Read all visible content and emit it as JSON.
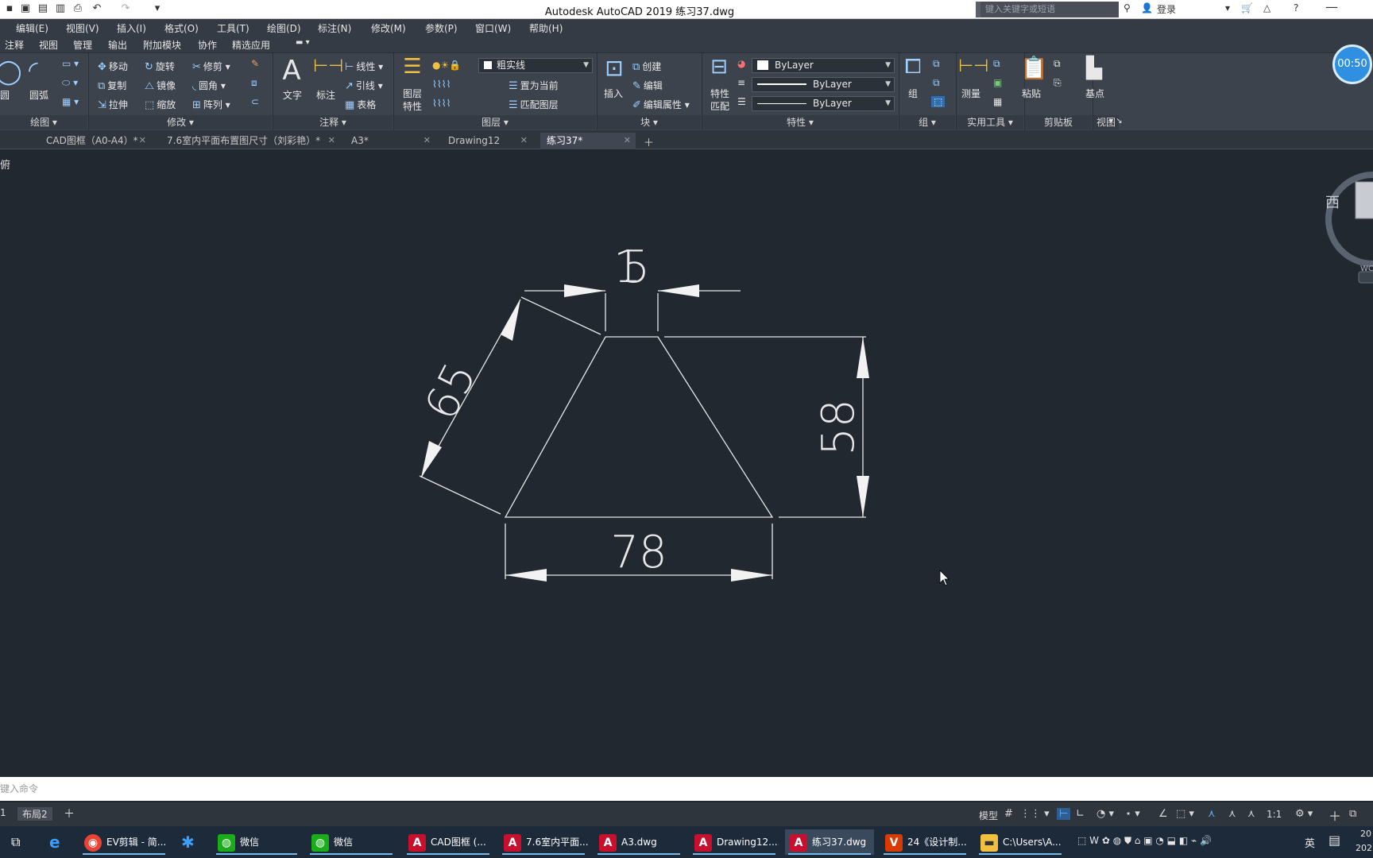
{
  "titlebar": {
    "title": "Autodesk AutoCAD 2019    练习37.dwg",
    "search_placeholder": "键入关键字或短语",
    "login": "登录"
  },
  "menubar": [
    "编辑(E)",
    "视图(V)",
    "插入(I)",
    "格式(O)",
    "工具(T)",
    "绘图(D)",
    "标注(N)",
    "修改(M)",
    "参数(P)",
    "窗口(W)",
    "帮助(H)"
  ],
  "ribbon_tabs": [
    "注释",
    "视图",
    "管理",
    "输出",
    "附加模块",
    "协作",
    "精选应用"
  ],
  "ribbon": {
    "draw": {
      "circle": "圆",
      "arc": "圆弧",
      "footer": "绘图"
    },
    "modify": {
      "move": "移动",
      "rotate": "旋转",
      "trim": "修剪",
      "copy": "复制",
      "mirror": "镜像",
      "fillet": "圆角",
      "stretch": "拉伸",
      "scale": "缩放",
      "array": "阵列",
      "footer": "修改"
    },
    "annotation": {
      "text": "文字",
      "dimension": "标注",
      "linear": "线性",
      "leader": "引线",
      "table": "表格",
      "footer": "注释"
    },
    "layers": {
      "properties_line1": "图层",
      "properties_line2": "特性",
      "current_layer": "粗实线",
      "make_current": "置为当前",
      "match_layer": "匹配图层",
      "footer": "图层"
    },
    "block": {
      "insert": "插入",
      "create": "创建",
      "edit": "编辑",
      "edit_attributes": "编辑属性",
      "footer": "块"
    },
    "properties": {
      "match_line1": "特性",
      "match_line2": "匹配",
      "color": "ByLayer",
      "linetype": "ByLayer",
      "lineweight": "ByLayer",
      "footer": "特性"
    },
    "groups": {
      "group": "组",
      "footer": "组"
    },
    "utilities": {
      "measure": "测量",
      "footer": "实用工具"
    },
    "clipboard": {
      "paste": "粘贴",
      "footer": "剪贴板"
    },
    "view": {
      "base": "基点",
      "footer": "视图"
    }
  },
  "doc_tabs": [
    "CAD图框（A0-A4）*",
    "7.6室内平面布置图尺寸（刘彩艳）*",
    "A3*",
    "Drawing12",
    "练习37*"
  ],
  "viewport_label": "俯",
  "viewcube": {
    "west": "西",
    "wcs": "WC"
  },
  "timer": "00:50",
  "drawing": {
    "dims": {
      "top": "15",
      "slant": "65",
      "height": "58",
      "bottom": "78"
    },
    "line_color": "#e8e8e8"
  },
  "command_placeholder": "键入命令",
  "layout_tabs": [
    "1",
    "布局2"
  ],
  "status": {
    "model": "模型",
    "scale": "1:1"
  },
  "taskbar": {
    "items": [
      "EV剪辑 - 简...",
      "微信",
      "微信",
      "CAD图框 (...",
      "7.6室内平面...",
      "A3.dwg",
      "Drawing12....",
      "练习37.dwg",
      "24《设计制...",
      "C:\\Users\\A..."
    ],
    "ime": "英",
    "clock_line1": "20",
    "clock_line2": "202"
  }
}
